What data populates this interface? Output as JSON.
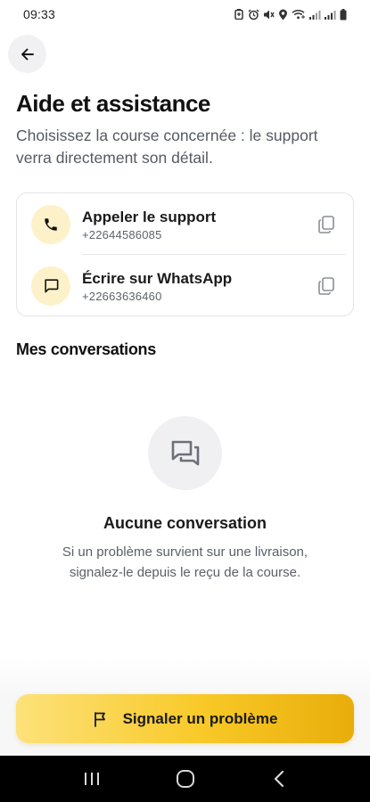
{
  "status_bar": {
    "time": "09:33",
    "icons": [
      "battery-saver-icon",
      "alarm-icon",
      "mute-icon",
      "location-icon",
      "wifi-icon",
      "signal-icon",
      "signal-icon",
      "battery-icon"
    ]
  },
  "header": {
    "back_icon": "arrow-left-icon",
    "title": "Aide et assistance",
    "subtitle": "Choisissez la course concernée : le support verra directement son détail."
  },
  "contacts": [
    {
      "label": "Appeler le support",
      "number": "+22644586085",
      "icon": "phone-icon",
      "action_icon": "copy-icon"
    },
    {
      "label": "Écrire sur WhatsApp",
      "number": "+22663636460",
      "icon": "message-icon",
      "action_icon": "copy-icon"
    }
  ],
  "conversations": {
    "section_title": "Mes conversations",
    "empty_icon": "chat-bubbles-icon",
    "empty_title": "Aucune conversation",
    "empty_description": "Si un problème survient sur une livraison, signalez-le depuis le reçu de la course."
  },
  "report_button": {
    "label": "Signaler un problème",
    "icon": "flag-icon"
  },
  "nav_bar": {
    "buttons": [
      "recents-icon",
      "home-icon",
      "back-icon"
    ]
  },
  "colors": {
    "accent_start": "#fde27a",
    "accent_end": "#e9ad0a",
    "icon_bg": "#fdf1c9"
  }
}
